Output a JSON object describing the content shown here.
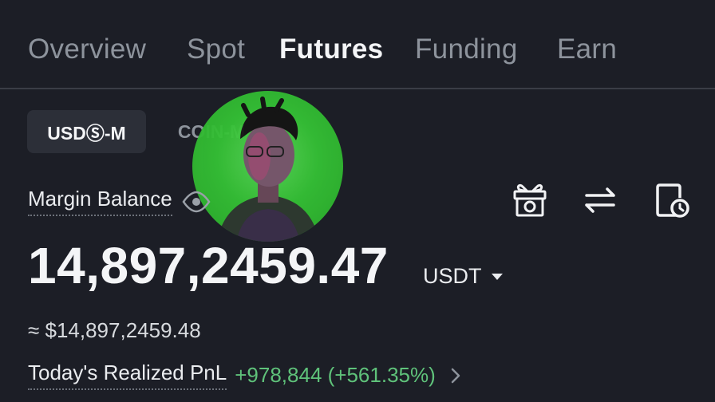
{
  "tabs": [
    {
      "label": "Overview",
      "active": false
    },
    {
      "label": "Spot",
      "active": false
    },
    {
      "label": "Futures",
      "active": true
    },
    {
      "label": "Funding",
      "active": false
    },
    {
      "label": "Earn",
      "active": false
    }
  ],
  "segments": {
    "active_label": "USDⓈ-M",
    "inactive_label": "COIN-M"
  },
  "margin_balance": {
    "label": "Margin Balance",
    "value": "14,897,2459.47",
    "currency": "USDT",
    "approx": "≈ $14,897,2459.48"
  },
  "pnl": {
    "label": "Today's Realized PnL",
    "value": "+978,844 (+561.35%)"
  },
  "icons": {
    "eye": "eye-icon",
    "gift": "gift-icon",
    "transfer": "transfer-icon",
    "history": "history-icon"
  },
  "colors": {
    "background": "#1c1e26",
    "positive": "#5fc27a",
    "avatar_bg": "#35c235"
  }
}
